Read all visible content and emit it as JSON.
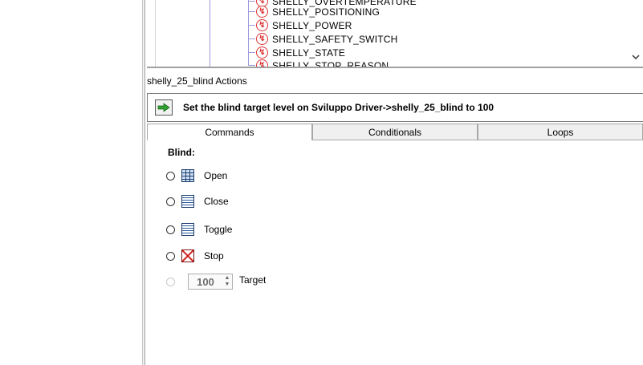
{
  "tree": {
    "items": [
      {
        "label": "SHELLY_OVERTEMPERATURE",
        "icon": "state-icon"
      },
      {
        "label": "SHELLY_POSITIONING",
        "icon": "state-icon"
      },
      {
        "label": "SHELLY_POWER",
        "icon": "state-icon"
      },
      {
        "label": "SHELLY_SAFETY_SWITCH",
        "icon": "state-icon"
      },
      {
        "label": "SHELLY_STATE",
        "icon": "state-icon"
      },
      {
        "label": "SHELLY_STOP_REASON",
        "icon": "state-icon"
      }
    ],
    "scroll_icon": "chevron-down-icon"
  },
  "actions": {
    "title": "shelly_25_blind Actions",
    "summary": "Set the blind target level on Sviluppo Driver->shelly_25_blind to 100",
    "summary_icon": "green-arrow-icon"
  },
  "tabs": [
    {
      "label": "Commands",
      "active": true
    },
    {
      "label": "Conditionals",
      "active": false
    },
    {
      "label": "Loops",
      "active": false
    }
  ],
  "commands": {
    "group_label": "Blind:",
    "options": [
      {
        "label": "Open",
        "icon": "blind-open-icon"
      },
      {
        "label": "Close",
        "icon": "blind-closed-icon"
      },
      {
        "label": "Toggle",
        "icon": "blind-toggle-icon"
      },
      {
        "label": "Stop",
        "icon": "blind-stop-icon"
      }
    ],
    "target": {
      "value": "100",
      "label": "Target"
    }
  },
  "colors": {
    "accent_red": "#d33333",
    "arrow_green": "#2fa12f",
    "tree_guide": "#9a9ad8"
  }
}
